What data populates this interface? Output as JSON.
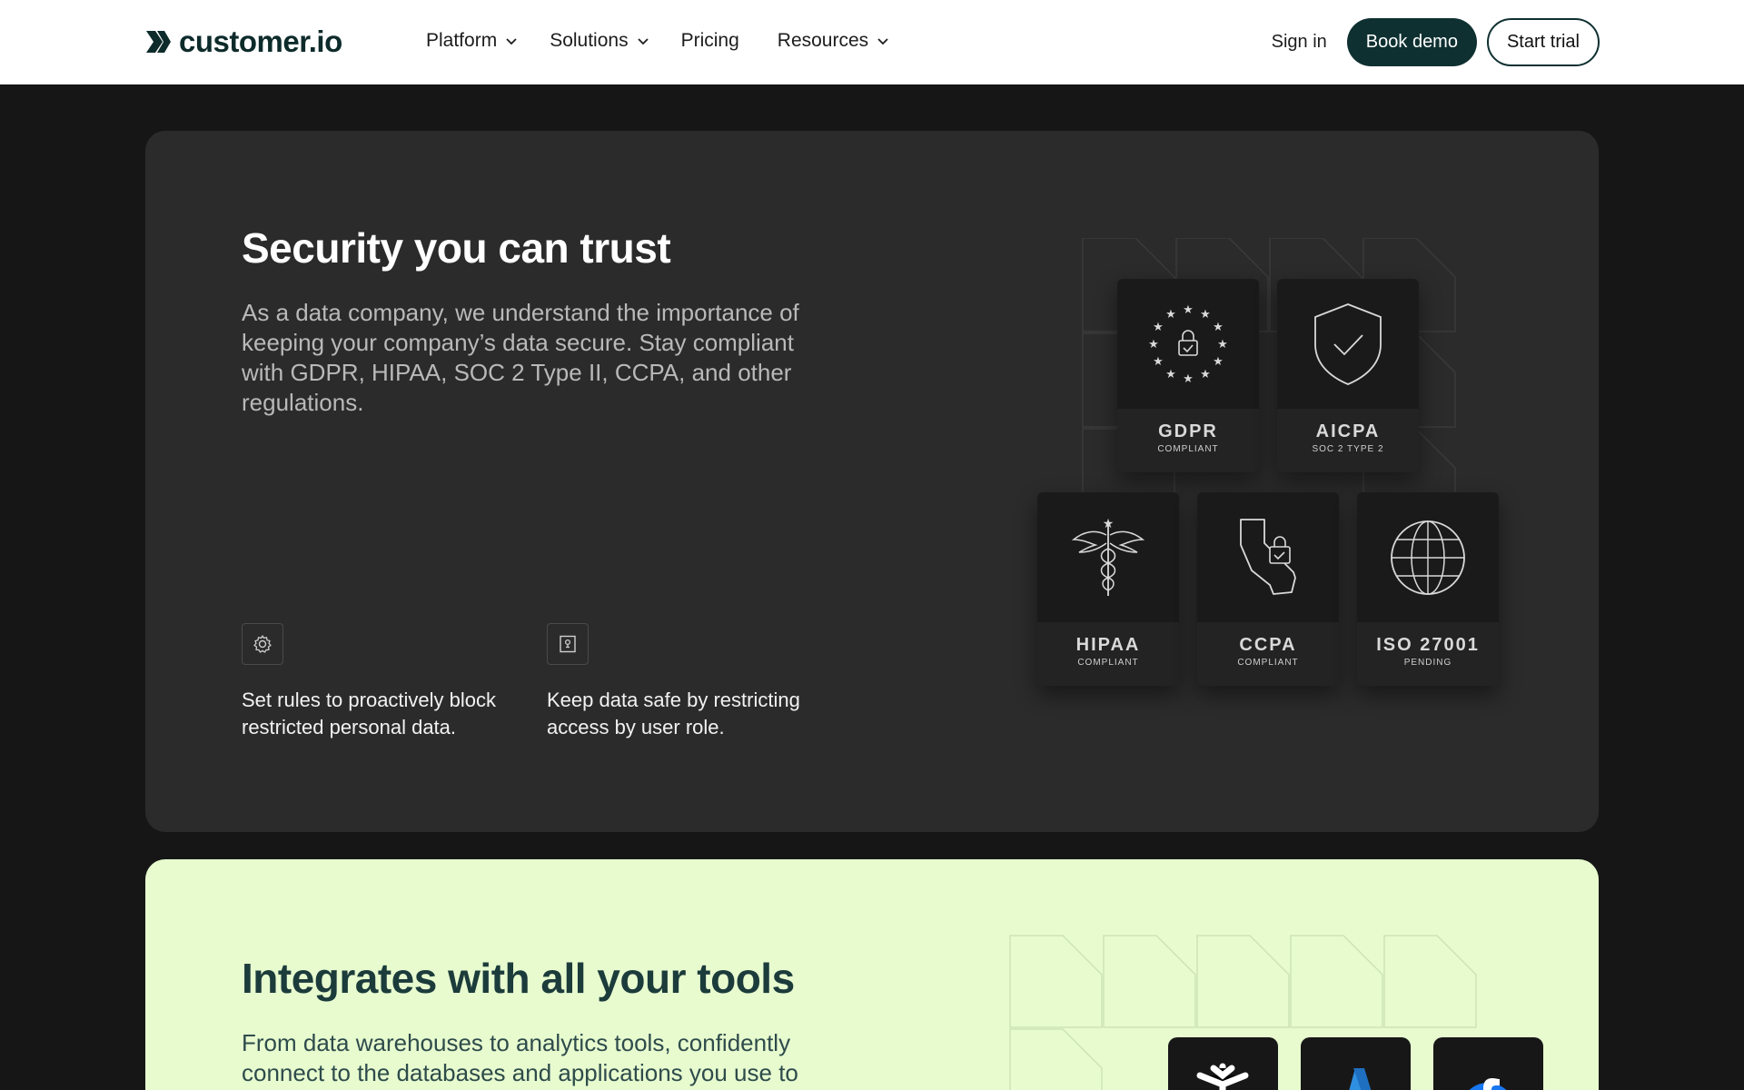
{
  "nav": {
    "logo_text": "customer.io",
    "menu": [
      {
        "label": "Platform",
        "has_dropdown": true
      },
      {
        "label": "Solutions",
        "has_dropdown": true
      },
      {
        "label": "Pricing",
        "has_dropdown": false
      },
      {
        "label": "Resources",
        "has_dropdown": true
      }
    ],
    "sign_in": "Sign in",
    "book_demo": "Book demo",
    "start_trial": "Start trial"
  },
  "security": {
    "title": "Security you can trust",
    "description": "As a data company, we understand the importance of keeping your company’s data secure. Stay compliant with GDPR, HIPAA, SOC 2 Type II, CCPA, and other regulations.",
    "features": [
      {
        "icon": "gear-icon",
        "text": "Set rules to proactively block restricted personal data."
      },
      {
        "icon": "lock-box-icon",
        "text": "Keep data safe by restricting access by user role."
      }
    ],
    "badges": [
      {
        "icon": "eu-stars-lock-icon",
        "name": "GDPR",
        "sub": "COMPLIANT"
      },
      {
        "icon": "shield-check-icon",
        "name": "AICPA",
        "sub": "SOC 2 TYPE 2"
      },
      {
        "icon": "caduceus-icon",
        "name": "HIPAA",
        "sub": "COMPLIANT"
      },
      {
        "icon": "california-lock-icon",
        "name": "CCPA",
        "sub": "COMPLIANT"
      },
      {
        "icon": "globe-icon",
        "name": "ISO 27001",
        "sub": "PENDING"
      }
    ]
  },
  "integrations": {
    "title": "Integrates with all your tools",
    "description": "From data warehouses to analytics tools, confidently connect to the databases and applications you use to",
    "tools": [
      {
        "icon": "snowflake-icon"
      },
      {
        "icon": "azure-icon"
      },
      {
        "icon": "facebook-icon"
      }
    ]
  },
  "colors": {
    "page_bg": "#161616",
    "card_dark": "#2b2b2b",
    "card_light": "#e7fbcf",
    "brand_dark": "#0f3031"
  }
}
